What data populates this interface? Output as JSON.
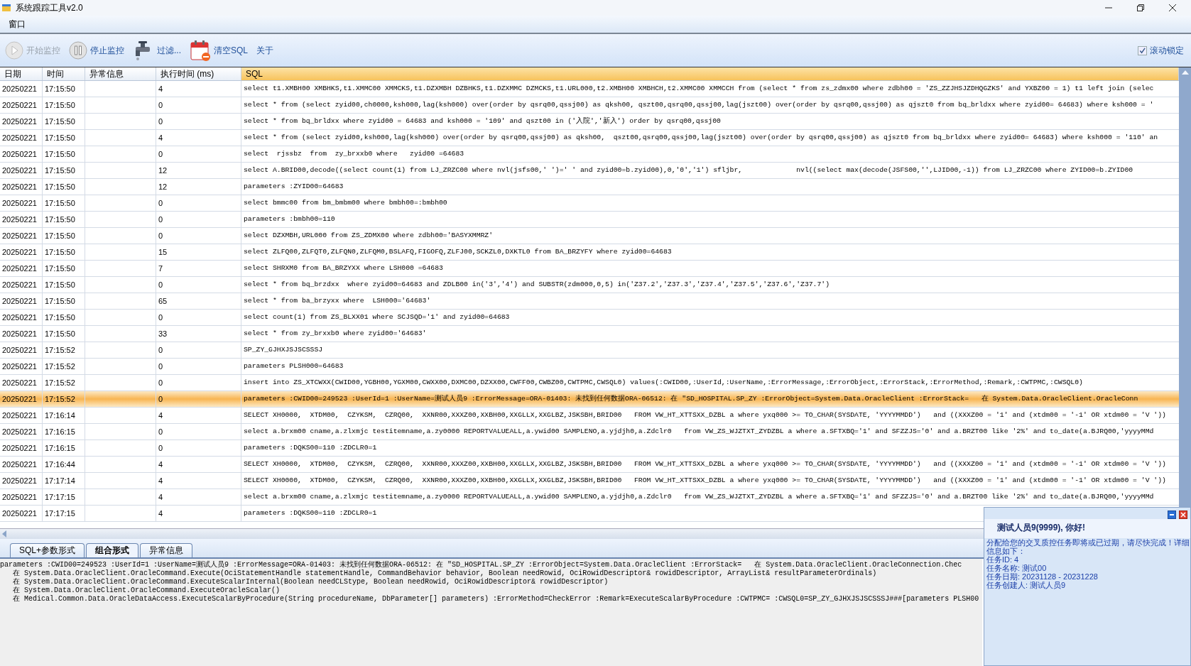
{
  "window": {
    "title": "系统跟踪工具v2.0"
  },
  "menu": [
    {
      "label": "窗口"
    }
  ],
  "toolbar": {
    "buttons": [
      {
        "label": "开始监控",
        "kind": "play",
        "disabled": true
      },
      {
        "label": "停止监控",
        "kind": "pause",
        "disabled": false
      },
      {
        "label": "过滤...",
        "kind": "filter",
        "disabled": false
      },
      {
        "label": "清空SQL",
        "kind": "clear",
        "disabled": false
      },
      {
        "label": "关于",
        "kind": "text",
        "disabled": false
      }
    ],
    "scroll_lock": {
      "label": "滚动锁定",
      "checked": true
    }
  },
  "table": {
    "columns": [
      {
        "label": "日期",
        "sorted": false
      },
      {
        "label": "时间",
        "sorted": false
      },
      {
        "label": "异常信息",
        "sorted": false
      },
      {
        "label": "执行时间 (ms)",
        "sorted": false
      },
      {
        "label": "SQL",
        "sorted": true
      }
    ],
    "rows": [
      {
        "date": "20250221",
        "time": "17:15:50",
        "duration": "4",
        "sql": "select t1.XMBH00 XMBHKS,t1.XMMC00 XMMCKS,t1.DZXMBH DZBHKS,t1.DZXMMC DZMCKS,t1.URL000,t2.XMBH00 XMBHCH,t2.XMMC00 XMMCCH from (select * from zs_zdmx00 where zdbh00 = 'ZS_ZZJHSJZDHQGZKS' and YXBZ00 = 1) t1 left join (selec",
        "selected": false
      },
      {
        "date": "20250221",
        "time": "17:15:50",
        "duration": "0",
        "sql": "select * from (select zyid00,ch0000,ksh000,lag(ksh000) over(order by qsrq00,qssj00) as qksh00, qszt00,qsrq00,qssj00,lag(jszt00) over(order by qsrq00,qssj00) as qjszt0 from bq_brldxx where zyid00= 64683) where ksh000 = '",
        "selected": false
      },
      {
        "date": "20250221",
        "time": "17:15:50",
        "duration": "0",
        "sql": "select * from bq_brldxx where zyid00 = 64683 and ksh000 = '109' and qszt00 in ('入院','新入') order by qsrq00,qssj00",
        "selected": false
      },
      {
        "date": "20250221",
        "time": "17:15:50",
        "duration": "4",
        "sql": "select * from (select zyid00,ksh000,lag(ksh000) over(order by qsrq00,qssj00) as qksh00,  qszt00,qsrq00,qssj00,lag(jszt00) over(order by qsrq00,qssj00) as qjszt0 from bq_brldxx where zyid00= 64683) where ksh000 = '110' an",
        "selected": false
      },
      {
        "date": "20250221",
        "time": "17:15:50",
        "duration": "0",
        "sql": "select  rjssbz  from  zy_brxxb0 where   zyid00 =64683",
        "selected": false
      },
      {
        "date": "20250221",
        "time": "17:15:50",
        "duration": "12",
        "sql": "select A.BRID00,decode((select count(1) from LJ_ZRZC00 where nvl(jsfs00,' ')=' ' and zyid00=b.zyid00),0,'0','1') sfljbr,             nvl((select max(decode(JSFS00,'',LJID00,-1)) from LJ_ZRZC00 where ZYID00=b.ZYID00",
        "selected": false
      },
      {
        "date": "20250221",
        "time": "17:15:50",
        "duration": "12",
        "sql": "parameters :ZYID00=64683",
        "selected": false
      },
      {
        "date": "20250221",
        "time": "17:15:50",
        "duration": "0",
        "sql": "select bmmc00 from bm_bmbm00 where bmbh00=:bmbh00",
        "selected": false
      },
      {
        "date": "20250221",
        "time": "17:15:50",
        "duration": "0",
        "sql": "parameters :bmbh00=110",
        "selected": false
      },
      {
        "date": "20250221",
        "time": "17:15:50",
        "duration": "0",
        "sql": "select DZXMBH,URL000 from ZS_ZDMX00 where zdbh00='BASYXMMRZ'",
        "selected": false
      },
      {
        "date": "20250221",
        "time": "17:15:50",
        "duration": "15",
        "sql": "select ZLFQ00,ZLFQT0,ZLFQN0,ZLFQM0,BSLAFQ,FIGOFQ,ZLFJ00,SCKZL0,DXKTL0 from BA_BRZYFY where zyid00=64683",
        "selected": false
      },
      {
        "date": "20250221",
        "time": "17:15:50",
        "duration": "7",
        "sql": "select SHRXM0 from BA_BRZYXX where LSH000 =64683",
        "selected": false
      },
      {
        "date": "20250221",
        "time": "17:15:50",
        "duration": "0",
        "sql": "select * from bq_brzdxx  where zyid00=64683 and ZDLB00 in('3','4') and SUBSTR(zdm000,0,5) in('Z37.2','Z37.3','Z37.4','Z37.5','Z37.6','Z37.7')",
        "selected": false
      },
      {
        "date": "20250221",
        "time": "17:15:50",
        "duration": "65",
        "sql": "select * from ba_brzyxx where  LSH000='64683'",
        "selected": false
      },
      {
        "date": "20250221",
        "time": "17:15:50",
        "duration": "0",
        "sql": "select count(1) from ZS_BLXX01 where SCJSQD='1' and zyid00=64683",
        "selected": false
      },
      {
        "date": "20250221",
        "time": "17:15:50",
        "duration": "33",
        "sql": "select * from zy_brxxb0 where zyid00='64683'",
        "selected": false
      },
      {
        "date": "20250221",
        "time": "17:15:52",
        "duration": "0",
        "sql": "SP_ZY_GJHXJSJSCSSSJ",
        "selected": false
      },
      {
        "date": "20250221",
        "time": "17:15:52",
        "duration": "0",
        "sql": "parameters PLSH000=64683",
        "selected": false
      },
      {
        "date": "20250221",
        "time": "17:15:52",
        "duration": "0",
        "sql": "insert into ZS_XTCWXX(CWID00,YGBH00,YGXM00,CWXX00,DXMC00,DZXX00,CWFF00,CWBZ00,CWTPMC,CWSQL0) values(:CWID00,:UserId,:UserName,:ErrorMessage,:ErrorObject,:ErrorStack,:ErrorMethod,:Remark,:CWTPMC,:CWSQL0)",
        "selected": false
      },
      {
        "date": "20250221",
        "time": "17:15:52",
        "duration": "0",
        "sql": "parameters :CWID00=249523 :UserId=1 :UserName=测试人员9 :ErrorMessage=ORA-01403: 未找到任何数据ORA-06512: 在 \"SD_HOSPITAL.SP_ZY :ErrorObject=System.Data.OracleClient :ErrorStack=   在 System.Data.OracleClient.OracleConn",
        "selected": true
      },
      {
        "date": "20250221",
        "time": "17:16:14",
        "duration": "4",
        "sql": "SELECT XH0000,  XTDM00,  CZYKSM,  CZRQ00,  XXNR00,XXXZ00,XXBH00,XXGLLX,XXGLBZ,JSKSBH,BRID00   FROM VW_HT_XTTSXX_DZBL a where yxq000 >= TO_CHAR(SYSDATE, 'YYYYMMDD')   and ((XXXZ00 = '1' and (xtdm00 = '-1' OR xtdm00 = 'V '))",
        "selected": false
      },
      {
        "date": "20250221",
        "time": "17:16:15",
        "duration": "0",
        "sql": "select a.brxm00 cname,a.zlxmjc testitemname,a.zy0000 REPORTVALUEALL,a.ywid00 SAMPLENO,a.yjdjh0,a.Zdclr0   from VW_ZS_WJZTXT_ZYDZBL a where a.SFTXBQ='1' and SFZZJS='0' and a.BRZT00 like '2%' and to_date(a.BJRQ00,'yyyyMMd",
        "selected": false
      },
      {
        "date": "20250221",
        "time": "17:16:15",
        "duration": "0",
        "sql": "parameters :DQKS00=110 :ZDCLR0=1",
        "selected": false
      },
      {
        "date": "20250221",
        "time": "17:16:44",
        "duration": "4",
        "sql": "SELECT XH0000,  XTDM00,  CZYKSM,  CZRQ00,  XXNR00,XXXZ00,XXBH00,XXGLLX,XXGLBZ,JSKSBH,BRID00   FROM VW_HT_XTTSXX_DZBL a where yxq000 >= TO_CHAR(SYSDATE, 'YYYYMMDD')   and ((XXXZ00 = '1' and (xtdm00 = '-1' OR xtdm00 = 'V '))",
        "selected": false
      },
      {
        "date": "20250221",
        "time": "17:17:14",
        "duration": "4",
        "sql": "SELECT XH0000,  XTDM00,  CZYKSM,  CZRQ00,  XXNR00,XXXZ00,XXBH00,XXGLLX,XXGLBZ,JSKSBH,BRID00   FROM VW_HT_XTTSXX_DZBL a where yxq000 >= TO_CHAR(SYSDATE, 'YYYYMMDD')   and ((XXXZ00 = '1' and (xtdm00 = '-1' OR xtdm00 = 'V '))",
        "selected": false
      },
      {
        "date": "20250221",
        "time": "17:17:15",
        "duration": "4",
        "sql": "select a.brxm00 cname,a.zlxmjc testitemname,a.zy0000 REPORTVALUEALL,a.ywid00 SAMPLENO,a.yjdjh0,a.Zdclr0   from VW_ZS_WJZTXT_ZYDZBL a where a.SFTXBQ='1' and SFZZJS='0' and a.BRZT00 like '2%' and to_date(a.BJRQ00,'yyyyMMd",
        "selected": false
      },
      {
        "date": "20250221",
        "time": "17:17:15",
        "duration": "4",
        "sql": "parameters :DQKS00=110 :ZDCLR0=1",
        "selected": false
      }
    ]
  },
  "tabs": [
    {
      "label": "SQL+参数形式",
      "selected": false
    },
    {
      "label": "组合形式",
      "selected": true
    },
    {
      "label": "异常信息",
      "selected": false
    }
  ],
  "detail": {
    "lines": [
      "parameters :CWID00=249523 :UserId=1 :UserName=测试人员9 :ErrorMessage=ORA-01403: 未找到任何数据ORA-06512: 在 \"SD_HOSPITAL.SP_ZY :ErrorObject=System.Data.OracleClient :ErrorStack=   在 System.Data.OracleClient.OracleConnection.Chec",
      "   在 System.Data.OracleClient.OracleCommand.Execute(OciStatementHandle statementHandle, CommandBehavior behavior, Boolean needRowid, OciRowidDescriptor& rowidDescriptor, ArrayList& resultParameterOrdinals)",
      "   在 System.Data.OracleClient.OracleCommand.ExecuteScalarInternal(Boolean needCLStype, Boolean needRowid, OciRowidDescriptor& rowidDescriptor)",
      "   在 System.Data.OracleClient.OracleCommand.ExecuteOracleScalar()",
      "   在 Medical.Common.Data.OracleDataAccess.ExecuteScalarByProcedure(String procedureName, DbParameter[] parameters) :ErrorMethod=CheckError :Remark=ExecuteScalarByProcedure :CWTPMC= :CWSQL0=SP_ZY_GJHXJSJSCSSSJ###[parameters PLSH00"
    ]
  },
  "notification": {
    "title": "测试人员9(9999), 你好!",
    "message": "分配给您的交叉质控任务即将或已过期，请尽快完成！详细信息如下：",
    "details": [
      "任务ID: 4",
      "任务名称: 测试00",
      "任务日期: 20231128 - 20231228",
      "任务创建人: 测试人员9"
    ]
  }
}
